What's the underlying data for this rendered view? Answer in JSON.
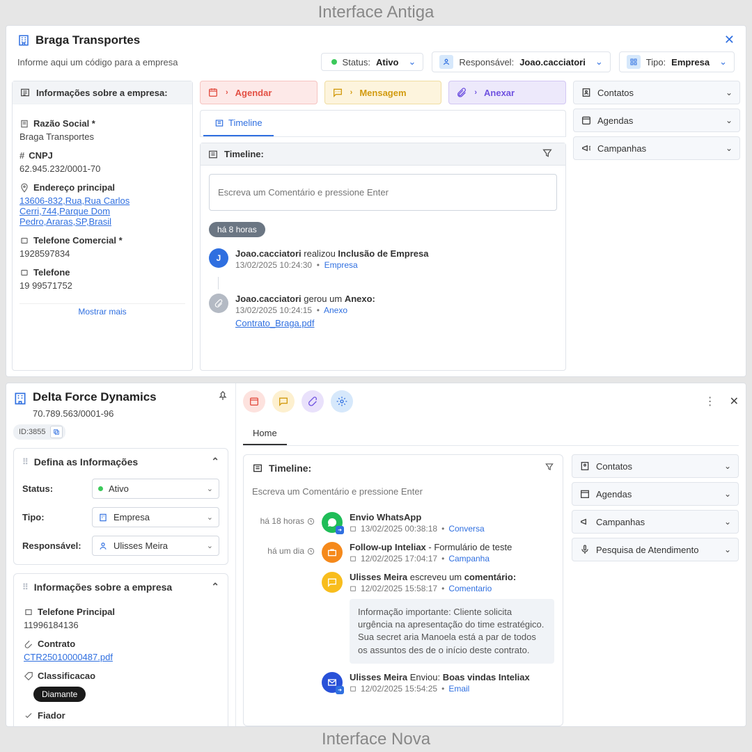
{
  "labels": {
    "top_title": "Interface Antiga",
    "bottom_title": "Interface Nova"
  },
  "old": {
    "company": "Braga Transportes",
    "code_hint": "Informe aqui um código para a empresa",
    "status_chip": {
      "label": "Status:",
      "value": "Ativo"
    },
    "resp_chip": {
      "label": "Responsável:",
      "value": "Joao.cacciatori"
    },
    "type_chip": {
      "label": "Tipo:",
      "value": "Empresa"
    },
    "info_header": "Informações sobre a empresa:",
    "fields": {
      "razao_label": "Razão Social *",
      "razao_value": "Braga Transportes",
      "cnpj_label": "CNPJ",
      "cnpj_value": "62.945.232/0001-70",
      "addr_label": "Endereço principal",
      "addr_value": "13606-832,Rua,Rua Carlos Cerri,744,Parque Dom Pedro,Araras,SP,Brasil",
      "tel_label": "Telefone Comercial *",
      "tel_value": "1928597834",
      "tel2_label": "Telefone",
      "tel2_value": "19 99571752"
    },
    "show_more": "Mostrar mais",
    "actions": {
      "agendar": "Agendar",
      "mensagem": "Mensagem",
      "anexar": "Anexar"
    },
    "tab_timeline": "Timeline",
    "timeline_header": "Timeline:",
    "timeline_placeholder": "Escreva um Comentário e pressione Enter",
    "age": "há 8 horas",
    "entry1": {
      "user": "Joao.cacciatori",
      "verb": " realizou ",
      "action": "Inclusão de Empresa",
      "ts": "13/02/2025 10:24:30",
      "tag": "Empresa"
    },
    "entry2": {
      "user": "Joao.cacciatori",
      "verb": " gerou um ",
      "action": "Anexo:",
      "ts": "13/02/2025 10:24:15",
      "tag": "Anexo",
      "file": "Contrato_Braga.pdf"
    },
    "accordions": [
      "Contatos",
      "Agendas",
      "Campanhas"
    ]
  },
  "new": {
    "company": "Delta Force Dynamics",
    "cnpj": "70.789.563/0001-96",
    "id": "ID:3855",
    "card1_title": "Defina as Informações",
    "form": {
      "status_lbl": "Status:",
      "status_val": "Ativo",
      "tipo_lbl": "Tipo:",
      "tipo_val": "Empresa",
      "resp_lbl": "Responsável:",
      "resp_val": "Ulisses Meira"
    },
    "card2_title": "Informações sobre a empresa",
    "c2": {
      "tel_lbl": "Telefone Principal",
      "tel_val": "11996184136",
      "contr_lbl": "Contrato",
      "contr_val": "CTR25010000487.pdf",
      "class_lbl": "Classificacao",
      "class_val": "Diamante",
      "fiador_lbl": "Fiador"
    },
    "home_tab": "Home",
    "timeline_header": "Timeline:",
    "timeline_placeholder": "Escreva um Comentário e pressione Enter",
    "feed": {
      "r1": {
        "time": "há 18 horas",
        "title": "Envio WhatsApp",
        "ts": "13/02/2025 00:38:18",
        "tag": "Conversa"
      },
      "r2": {
        "time": "há um dia",
        "title_b": "Follow-up Inteliax",
        "title_rest": " - Formulário de teste",
        "ts": "12/02/2025 17:04:17",
        "tag": "Campanha"
      },
      "r3": {
        "user": "Ulisses Meira",
        "mid": " escreveu um ",
        "act": "comentário:",
        "ts": "12/02/2025 15:58:17",
        "tag": "Comentario",
        "note": "Informação importante: Cliente solicita urgência na apresentação do time estratégico. Sua secret aria Manoela está a par de todos os assuntos des de o início deste contrato."
      },
      "r4": {
        "user": "Ulisses Meira",
        "mid": " Enviou: ",
        "act": "Boas vindas Inteliax",
        "ts": "12/02/2025 15:54:25",
        "tag": "Email"
      }
    },
    "accordions": [
      "Contatos",
      "Agendas",
      "Campanhas",
      "Pesquisa de Atendimento"
    ]
  }
}
